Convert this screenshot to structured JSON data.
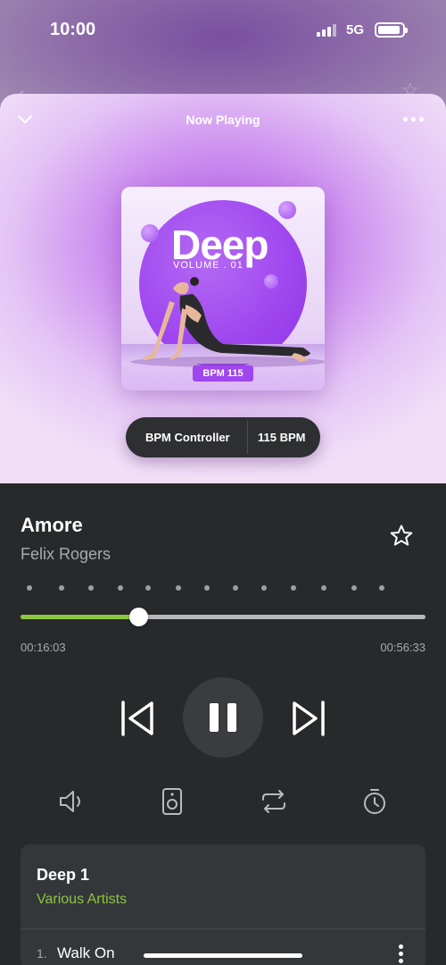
{
  "status_bar": {
    "time": "10:00",
    "network": "5G"
  },
  "now_playing": {
    "header_title": "Now Playing",
    "album_art": {
      "title": "Deep",
      "volume": "VOLUME . 01",
      "bpm_badge": "BPM 115"
    },
    "bpm_controller": {
      "label": "BPM Controller",
      "value": "115 BPM"
    }
  },
  "track": {
    "title": "Amore",
    "artist": "Felix Rogers",
    "progress_fraction": 0.29,
    "current_time": "00:16:03",
    "total_time": "00:56:33"
  },
  "controls": {
    "icons": [
      "previous-icon",
      "pause-icon",
      "next-icon"
    ],
    "secondary_icons": [
      "volume-icon",
      "speaker-icon",
      "repeat-icon",
      "timer-icon"
    ]
  },
  "playlist": {
    "title": "Deep 1",
    "subtitle": "Various Artists",
    "items": [
      {
        "number": "1.",
        "title": "Walk On"
      }
    ]
  },
  "colors": {
    "accent_green": "#8cc63f",
    "purple": "#a046ef",
    "dark_bg": "#27292b"
  }
}
